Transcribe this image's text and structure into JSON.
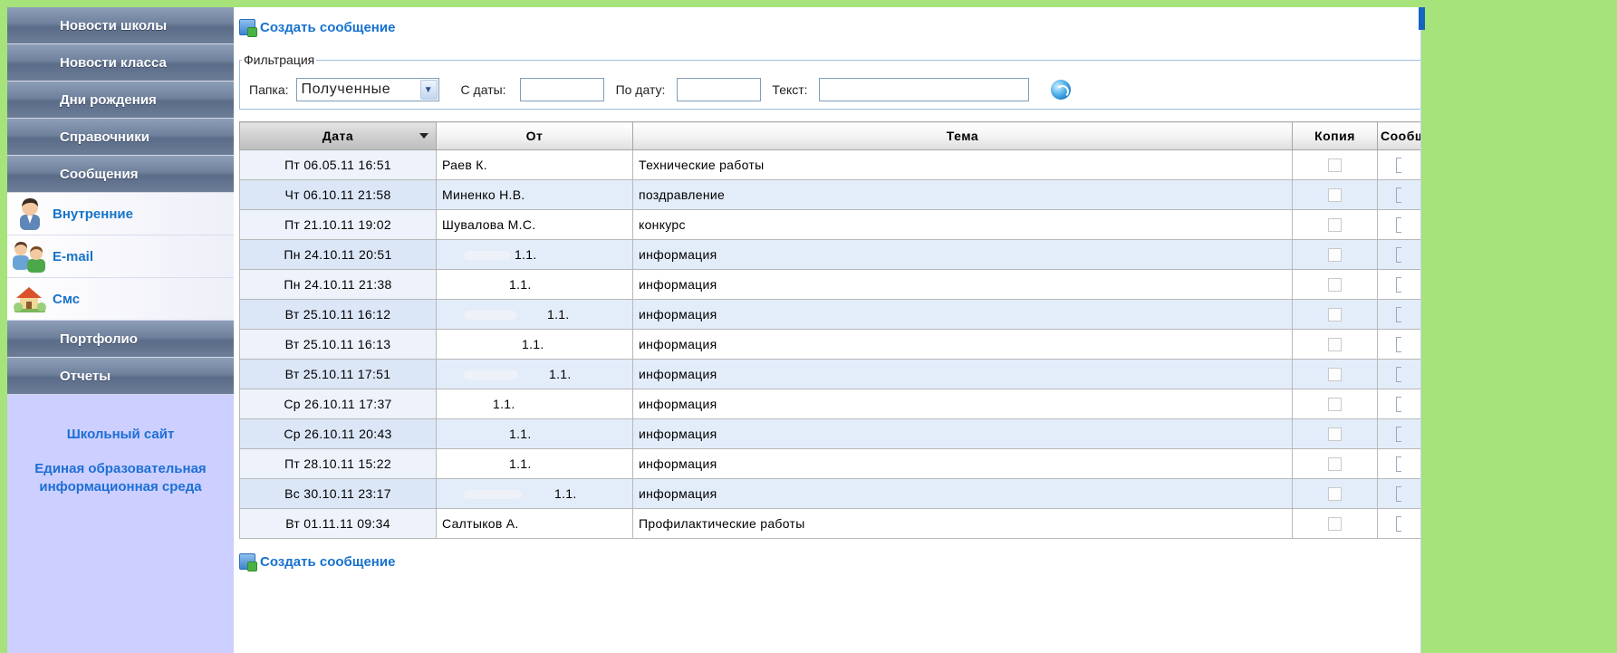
{
  "sidebar": {
    "nav_top": [
      "Новости школы",
      "Новости класса",
      "Дни рождения",
      "Справочники",
      "Сообщения"
    ],
    "sub_items": [
      {
        "label": "Внутренние",
        "icon": "user-icon"
      },
      {
        "label": "E-mail",
        "icon": "users-icon"
      },
      {
        "label": "Смс",
        "icon": "house-icon"
      }
    ],
    "nav_bottom": [
      "Портфолио",
      "Отчеты"
    ],
    "links": [
      "Школьный сайт",
      "Единая образовательная информационная среда"
    ]
  },
  "main": {
    "create_label": "Создать сообщение",
    "filter": {
      "legend": "Фильтрация",
      "folder_label": "Папка:",
      "folder_value": "Полученные",
      "from_label": "С даты:",
      "to_label": "По дату:",
      "text_label": "Текст:",
      "from_value": "",
      "to_value": "",
      "text_value": ""
    },
    "table": {
      "columns": [
        "Дата",
        "От",
        "Тема",
        "Копия",
        "Сообщ"
      ],
      "rows": [
        {
          "date": "Пт 06.05.11 16:51",
          "from": "Раев К.",
          "subject": "Технические работы"
        },
        {
          "date": "Чт 06.10.11 21:58",
          "from": "Миненко Н.В.",
          "subject": "поздравление"
        },
        {
          "date": "Пт 21.10.11 19:02",
          "from": "Шувалова М.С.",
          "subject": "конкурс"
        },
        {
          "date": "Пн 24.10.11 20:51",
          "from": "1.1.",
          "subject": "информация"
        },
        {
          "date": "Пн 24.10.11 21:38",
          "from": "1.1.",
          "subject": "информация"
        },
        {
          "date": "Вт 25.10.11 16:12",
          "from": "1.1.",
          "subject": "информация"
        },
        {
          "date": "Вт 25.10.11 16:13",
          "from": "1.1.",
          "subject": "информация"
        },
        {
          "date": "Вт 25.10.11 17:51",
          "from": "1.1.",
          "subject": "информация"
        },
        {
          "date": "Ср 26.10.11 17:37",
          "from": "1.1.",
          "subject": "информация"
        },
        {
          "date": "Ср 26.10.11 20:43",
          "from": "1.1.",
          "subject": "информация"
        },
        {
          "date": "Пт 28.10.11 15:22",
          "from": "1.1.",
          "subject": "информация"
        },
        {
          "date": "Вс 30.10.11 23:17",
          "from": "1.1.",
          "subject": "информация"
        },
        {
          "date": "Вт 01.11.11 09:34",
          "from": "Салтыков А.",
          "subject": "Профилактические работы"
        }
      ]
    }
  }
}
